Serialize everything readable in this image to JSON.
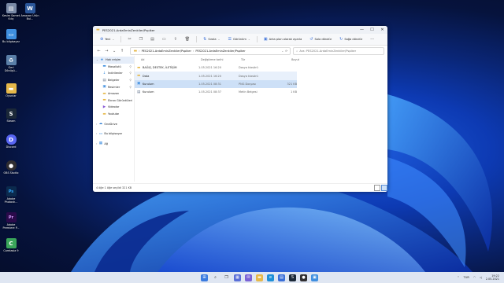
{
  "desktop": {
    "icons": [
      {
        "label": "Kesim Samet Kılıç",
        "glyph": "▤",
        "color": "#7a8aa6"
      },
      {
        "label": "Amazon Ürün Bul...",
        "glyph": "W",
        "color": "#2b579a"
      },
      {
        "label": "Bu bilgisayar",
        "glyph": "▭",
        "color": "#3f8fe0"
      },
      {
        "label": "Geri Dönüşü...",
        "glyph": "♻",
        "color": "#5a7fa8"
      },
      {
        "label": "Oyunlar",
        "glyph": "▬",
        "color": "#e6b84a"
      },
      {
        "label": "Steam",
        "glyph": "S",
        "color": "#1b2838"
      },
      {
        "label": "Discord",
        "glyph": "D",
        "color": "#5865f2"
      },
      {
        "label": "OBS Studio",
        "glyph": "●",
        "color": "#302e31"
      },
      {
        "label": "Adobe Photosh...",
        "glyph": "Ps",
        "color": "#0b2a4d"
      },
      {
        "label": "Adobe Premiere P...",
        "glyph": "Pr",
        "color": "#2a0a4a"
      },
      {
        "label": "Camtasia 9",
        "glyph": "C",
        "color": "#3aa55a"
      }
    ]
  },
  "window": {
    "title": "PES2021-ArdaEminZenkiler/Pspiker",
    "controls": {
      "minimize": "—",
      "maximize": "☐",
      "close": "✕"
    }
  },
  "toolbar": {
    "new_label": "Yeni",
    "sort_label": "Sırala",
    "view_label": "Görünüm",
    "wallpaper_label": "Arka plan olarak ayarla",
    "rotate_left_label": "Sola döndür",
    "rotate_right_label": "Sağa döndür",
    "more_label": "···"
  },
  "address": {
    "crumbs": [
      "PES2021-ArdaEminZenkiler/Pspiker",
      "PES2021-ArdaEminZenkiler/Pspiker"
    ],
    "search_placeholder": "Ara: PES2021-ArdaEminZenkiler/Pspiker"
  },
  "sidebar": {
    "items": [
      {
        "label": "Hızlı erişim",
        "icon": "★",
        "color": "#e6b84a",
        "indent": false,
        "pin": false,
        "active": true
      },
      {
        "label": "Masaüstü",
        "icon": "▬",
        "color": "#3f8fe0",
        "indent": true,
        "pin": true
      },
      {
        "label": "İndirilenler",
        "icon": "↓",
        "color": "#3f8fe0",
        "indent": true,
        "pin": true
      },
      {
        "label": "Belgeler",
        "icon": "▤",
        "color": "#6b7b93",
        "indent": true,
        "pin": true
      },
      {
        "label": "Resimler",
        "icon": "▣",
        "color": "#3f8fe0",
        "indent": true,
        "pin": true
      },
      {
        "label": "Amazon",
        "icon": "▬",
        "color": "#e6b84a",
        "indent": true,
        "pin": false
      },
      {
        "label": "Ekran Görüntüleri",
        "icon": "▬",
        "color": "#e6b84a",
        "indent": true,
        "pin": false
      },
      {
        "label": "Videolar",
        "icon": "▶",
        "color": "#8a5cd6",
        "indent": true,
        "pin": false
      },
      {
        "label": "Youtube",
        "icon": "▬",
        "color": "#e6b84a",
        "indent": true,
        "pin": false
      },
      {
        "label": "",
        "icon": "",
        "color": "#fff",
        "indent": false,
        "pin": false
      },
      {
        "label": "OneDrive",
        "icon": "☁",
        "color": "#2b7cd3",
        "indent": false,
        "pin": false
      },
      {
        "label": "",
        "icon": "",
        "color": "#fff",
        "indent": false,
        "pin": false
      },
      {
        "label": "Bu bilgisayar",
        "icon": "▭",
        "color": "#3f8fe0",
        "indent": false,
        "pin": false
      },
      {
        "label": "",
        "icon": "",
        "color": "#fff",
        "indent": false,
        "pin": false
      },
      {
        "label": "Ağ",
        "icon": "▦",
        "color": "#3f8fe0",
        "indent": false,
        "pin": false
      }
    ]
  },
  "files": {
    "columns": {
      "name": "Ad",
      "date": "Değiştirme tarihi",
      "type": "Tür",
      "size": "Boyut"
    },
    "rows": [
      {
        "name": "BAĞIŞ, DESTEK, İLETİŞİM",
        "date": "1.05.2021 16:20",
        "type": "Dosya klasörü",
        "size": "",
        "icon": "▬",
        "color": "#e6b84a",
        "state": ""
      },
      {
        "name": "Data",
        "date": "1.05.2021 16:20",
        "type": "Dosya klasörü",
        "size": "",
        "icon": "▬",
        "color": "#e6b84a",
        "state": "hover"
      },
      {
        "name": "Kurulum",
        "date": "1.05.2021 08:31",
        "type": "PNG Dosyası",
        "size": "321 KB",
        "icon": "▣",
        "color": "#3f8fe0",
        "state": "sel"
      },
      {
        "name": "Kurulum",
        "date": "1.05.2021 08:37",
        "type": "Metin Belgesi",
        "size": "1 KB",
        "icon": "▤",
        "color": "#6b7b93",
        "state": ""
      }
    ]
  },
  "status": {
    "text": "4 öğe   1 öğe seçildi  321 KB"
  },
  "taskbar": {
    "clock_time": "19:22",
    "clock_date": "2.05.2021",
    "language": "TUR"
  }
}
